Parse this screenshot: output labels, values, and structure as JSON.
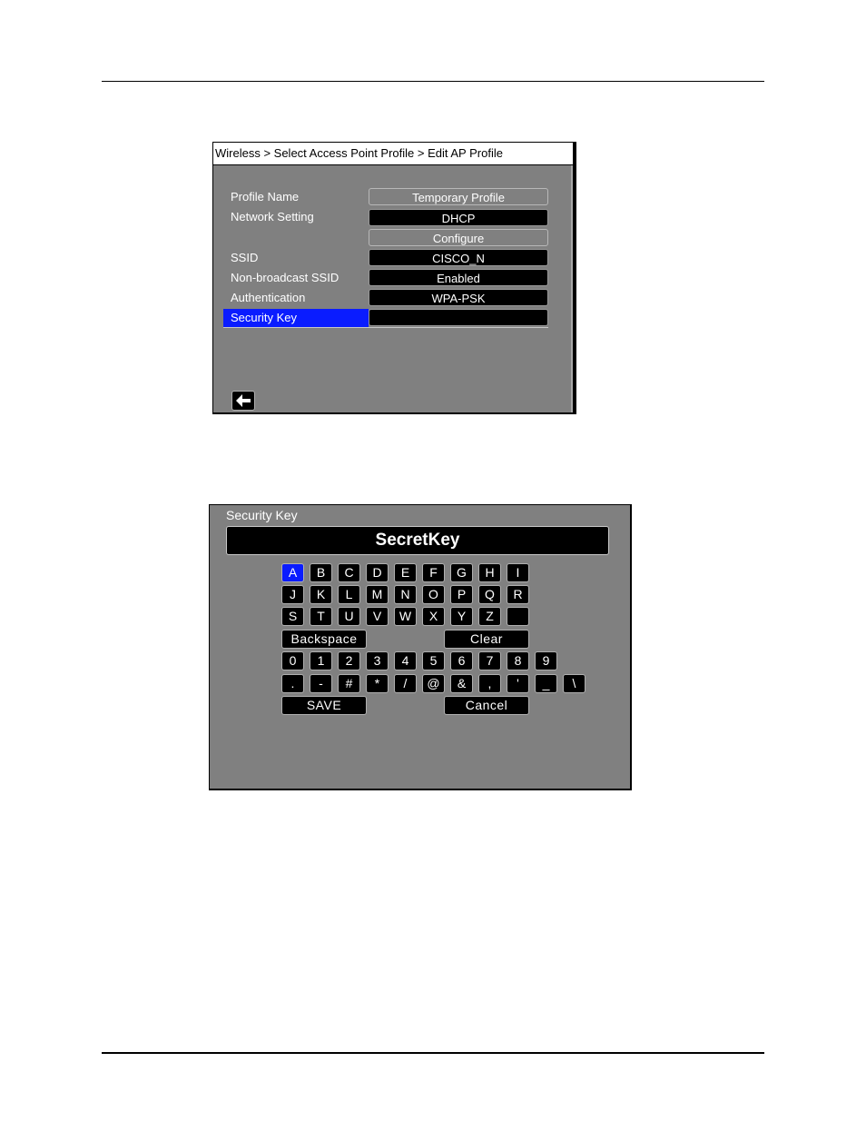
{
  "ap_profile_screen": {
    "breadcrumb": "Wireless > Select Access Point Profile > Edit AP Profile",
    "rows": [
      {
        "label": "Profile Name",
        "value": "Temporary Profile",
        "style": "light"
      },
      {
        "label": "Network Setting",
        "value": "DHCP",
        "style": "dark"
      },
      {
        "label": "",
        "value": "Configure",
        "style": "light"
      },
      {
        "label": "SSID",
        "value": "CISCO_N",
        "style": "dark"
      },
      {
        "label": "Non-broadcast SSID",
        "value": "Enabled",
        "style": "dark"
      },
      {
        "label": "Authentication",
        "value": "WPA-PSK",
        "style": "dark"
      },
      {
        "label": "Security Key",
        "value": "",
        "style": "dark",
        "selected": true
      }
    ],
    "back_icon": "left-arrow-icon",
    "colors": {
      "background": "#808080",
      "selection": "#0a1cff",
      "field": "#000000"
    }
  },
  "keyboard_screen": {
    "title": "Security Key",
    "entry_value": "SecretKey",
    "letter_rows": [
      [
        "A",
        "B",
        "C",
        "D",
        "E",
        "F",
        "G",
        "H",
        "I"
      ],
      [
        "J",
        "K",
        "L",
        "M",
        "N",
        "O",
        "P",
        "Q",
        "R"
      ],
      [
        "S",
        "T",
        "U",
        "V",
        "W",
        "X",
        "Y",
        "Z",
        ""
      ]
    ],
    "active_key": "A",
    "backspace_label": "Backspace",
    "clear_label": "Clear",
    "digits": [
      "0",
      "1",
      "2",
      "3",
      "4",
      "5",
      "6",
      "7",
      "8",
      "9"
    ],
    "symbols": [
      ".",
      "-",
      "#",
      "*",
      "/",
      "@",
      "&",
      ",",
      "'",
      "_",
      "\\"
    ],
    "save_label": "SAVE",
    "cancel_label": "Cancel"
  }
}
